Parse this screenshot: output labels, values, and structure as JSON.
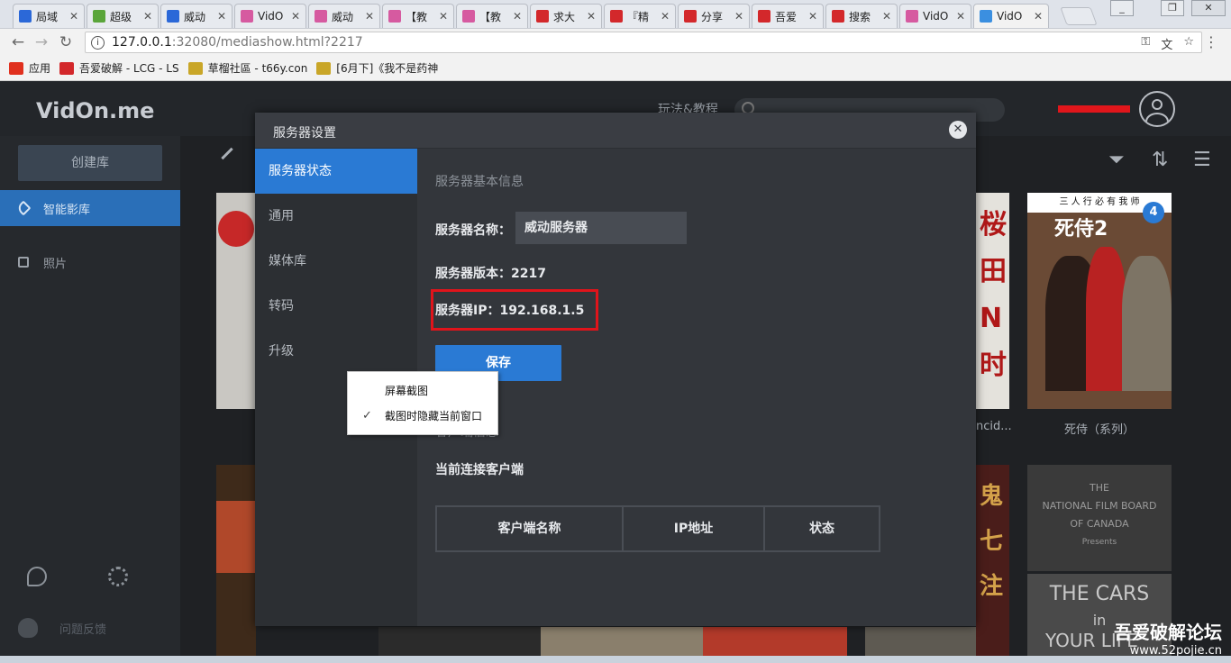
{
  "browser": {
    "tabs": [
      {
        "title": "局域",
        "favicon_color": "#2b68d8"
      },
      {
        "title": "超级",
        "favicon_color": "#5aa53a"
      },
      {
        "title": "威动",
        "favicon_color": "#2b68d8"
      },
      {
        "title": "VidO",
        "favicon_color": "#d65aa0"
      },
      {
        "title": "威动",
        "favicon_color": "#d65aa0"
      },
      {
        "title": "【教",
        "favicon_color": "#d65aa0"
      },
      {
        "title": "【教",
        "favicon_color": "#d65aa0"
      },
      {
        "title": "求大",
        "favicon_color": "#d3282b"
      },
      {
        "title": "『精",
        "favicon_color": "#d3282b"
      },
      {
        "title": "分享",
        "favicon_color": "#d3282b"
      },
      {
        "title": "吾爱",
        "favicon_color": "#d3282b"
      },
      {
        "title": "搜索",
        "favicon_color": "#d3282b"
      },
      {
        "title": "VidO",
        "favicon_color": "#d65aa0"
      },
      {
        "title": "VidO",
        "favicon_color": "#3b8fe0",
        "active": true
      }
    ],
    "url_host": "127.0.0.1",
    "url_rest": ":32080/mediashow.html?2217",
    "bookmarks": [
      {
        "label": "应用",
        "icon_color": "#e0301e"
      },
      {
        "label": "吾爱破解 - LCG - LS",
        "icon_color": "#d3282b"
      },
      {
        "label": "草榴社區 - t66y.con",
        "icon_color": "#c9a628"
      },
      {
        "label": "[6月下]《我不是药神",
        "icon_color": "#c9a628"
      }
    ]
  },
  "app": {
    "logo": "VidOn.me",
    "guide_link": "玩法&教程",
    "create_library": "创建库",
    "sidebar": [
      {
        "label": "智能影库",
        "active": true
      },
      {
        "label": "照片",
        "active": false
      }
    ],
    "feedback": "问题反馈",
    "posters": [
      {
        "caption": "ncid...",
        "color": "#7a3a2c"
      },
      {
        "caption": "死侍（系列）",
        "color": "#8a6a52"
      }
    ],
    "poster_texts": {
      "deadpool_top": "三 人 行 必 有 我 师",
      "deadpool_title": "死侍2",
      "deadpool_badge": "4",
      "nfb_line1": "THE",
      "nfb_line2": "NATIONAL FILM BOARD",
      "nfb_line3": "OF CANADA",
      "nfb_line4": "Presents",
      "cars_title": "THE CARS",
      "cars_sub": "in",
      "cars_bottom": "YOUR LIFE"
    }
  },
  "modal": {
    "title": "服务器设置",
    "nav": [
      {
        "label": "服务器状态",
        "active": true
      },
      {
        "label": "通用",
        "active": false
      },
      {
        "label": "媒体库",
        "active": false
      },
      {
        "label": "转码",
        "active": false
      },
      {
        "label": "升级",
        "active": false
      }
    ],
    "basic_info_title": "服务器基本信息",
    "server_name_label": "服务器名称：",
    "server_name_value": "威动服务器",
    "server_version_label": "服务器版本：2217",
    "server_ip_label": "服务器IP：192.168.1.5",
    "save_button": "保存",
    "client_info_title": "客户端信息",
    "connected_clients_title": "当前连接客户端",
    "table_headers": [
      "客户端名称",
      "IP地址",
      "状态"
    ]
  },
  "context_menu": {
    "items": [
      {
        "label": "屏幕截图",
        "checked": false
      },
      {
        "label": "截图时隐藏当前窗口",
        "checked": true
      }
    ]
  },
  "watermark": {
    "title": "吾爱破解论坛",
    "url": "www.52pojie.cn"
  }
}
